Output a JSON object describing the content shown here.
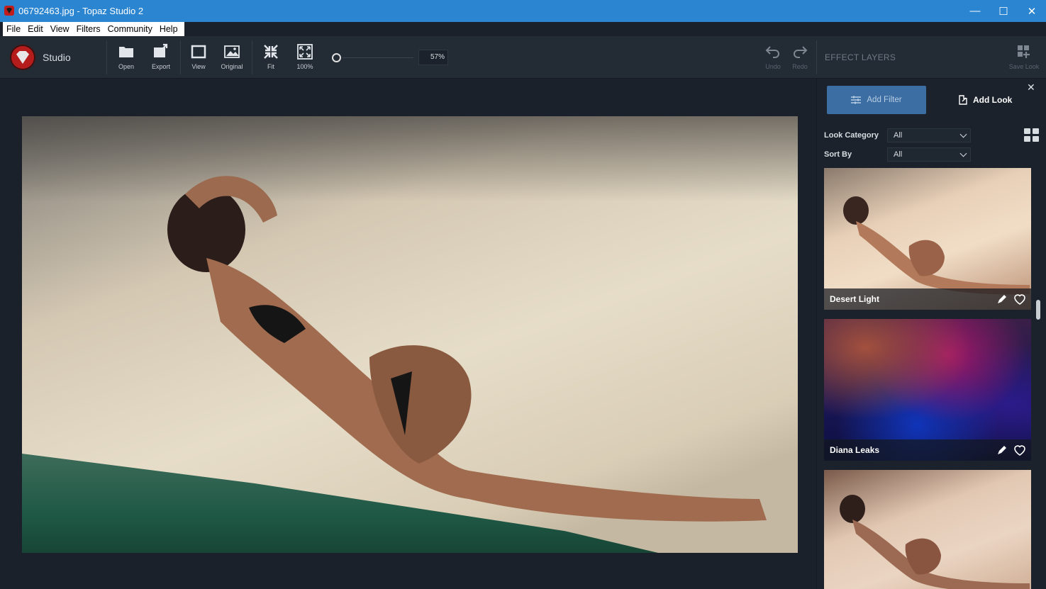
{
  "window": {
    "title": "06792463.jpg - Topaz Studio 2",
    "controls": {
      "minimize": "—",
      "maximize": "☐",
      "close": "✕"
    }
  },
  "menu": [
    "File",
    "Edit",
    "View",
    "Filters",
    "Community",
    "Help"
  ],
  "toolbar": {
    "studio_label": "Studio",
    "buttons": {
      "open": "Open",
      "export": "Export",
      "view": "View",
      "original": "Original",
      "fit": "Fit",
      "actual": "100%",
      "undo": "Undo",
      "redo": "Redo",
      "save_look": "Save Look"
    },
    "zoom_value": "57%",
    "effect_layers_label": "EFFECT LAYERS"
  },
  "panel": {
    "add_filter": "Add Filter",
    "add_look": "Add Look",
    "close": "✕",
    "look_category_label": "Look Category",
    "look_category_value": "All",
    "sort_by_label": "Sort By",
    "sort_by_value": "All",
    "looks": [
      {
        "name": "Desert Light"
      },
      {
        "name": "Diana Leaks"
      },
      {
        "name": ""
      }
    ]
  },
  "colors": {
    "titlebar": "#2b85d1",
    "toolbar": "#232b35",
    "background": "#1b212a",
    "accent_button": "#3d6ea3",
    "brand_red": "#b51c1c"
  }
}
